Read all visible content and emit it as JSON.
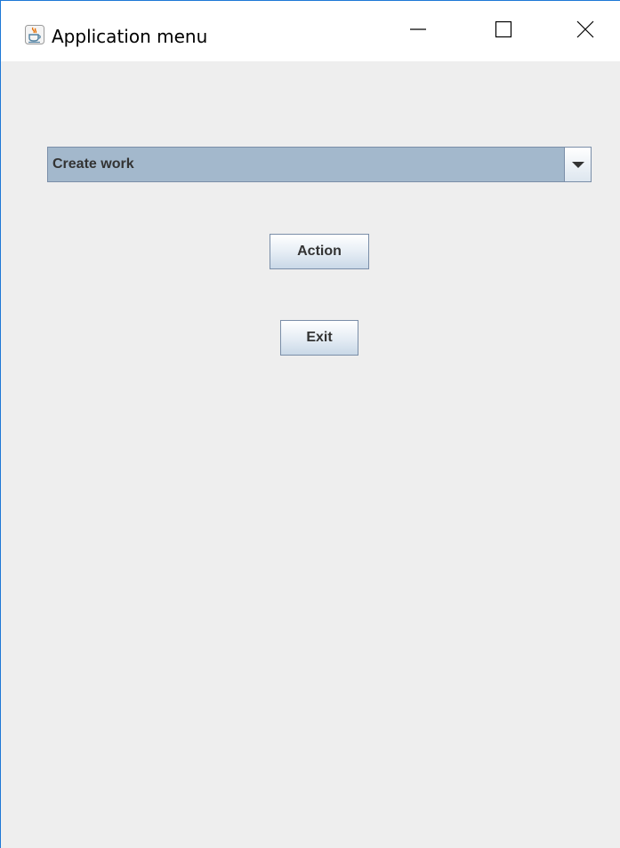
{
  "window": {
    "title": "Application menu"
  },
  "titlebar": {
    "app_icon": "java-cup-icon",
    "minimize_icon": "minimize-icon",
    "maximize_icon": "maximize-icon",
    "close_icon": "close-icon"
  },
  "combo": {
    "selected": "Create work",
    "arrow_icon": "chevron-down-icon"
  },
  "buttons": {
    "action_label": "Action",
    "exit_label": "Exit"
  },
  "colors": {
    "window_border": "#1e78d6",
    "background": "#eeeeee",
    "combo_selection": "#a3b8cc",
    "java_icon": "#e76f00"
  }
}
